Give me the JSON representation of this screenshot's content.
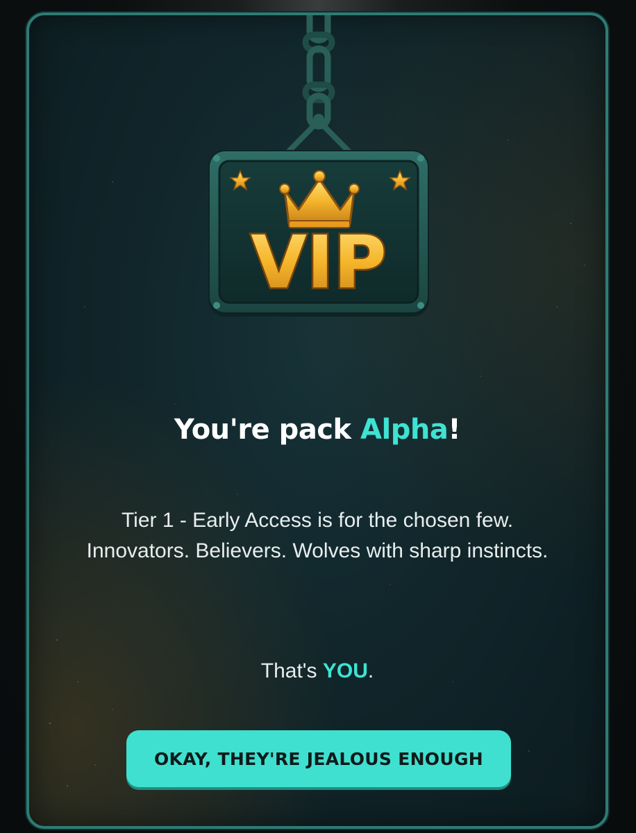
{
  "sign": {
    "label": "VIP",
    "icons": [
      "chain-icon",
      "crown-icon",
      "star-icon",
      "star-icon"
    ]
  },
  "title": {
    "prefix": "You're pack ",
    "highlight": "Alpha",
    "suffix": "!"
  },
  "body": {
    "text": "Tier 1 - Early Access is for the chosen few. Innovators. Believers. Wolves with sharp instincts."
  },
  "tagline": {
    "prefix": "That's ",
    "highlight": "YOU",
    "suffix": "."
  },
  "cta": {
    "label": "OKAY, THEY'RE JEALOUS ENOUGH"
  },
  "colors": {
    "accent": "#3ee3d2",
    "border": "#2e7b74",
    "gold": "#f5b52a",
    "panel": "#11262b"
  }
}
